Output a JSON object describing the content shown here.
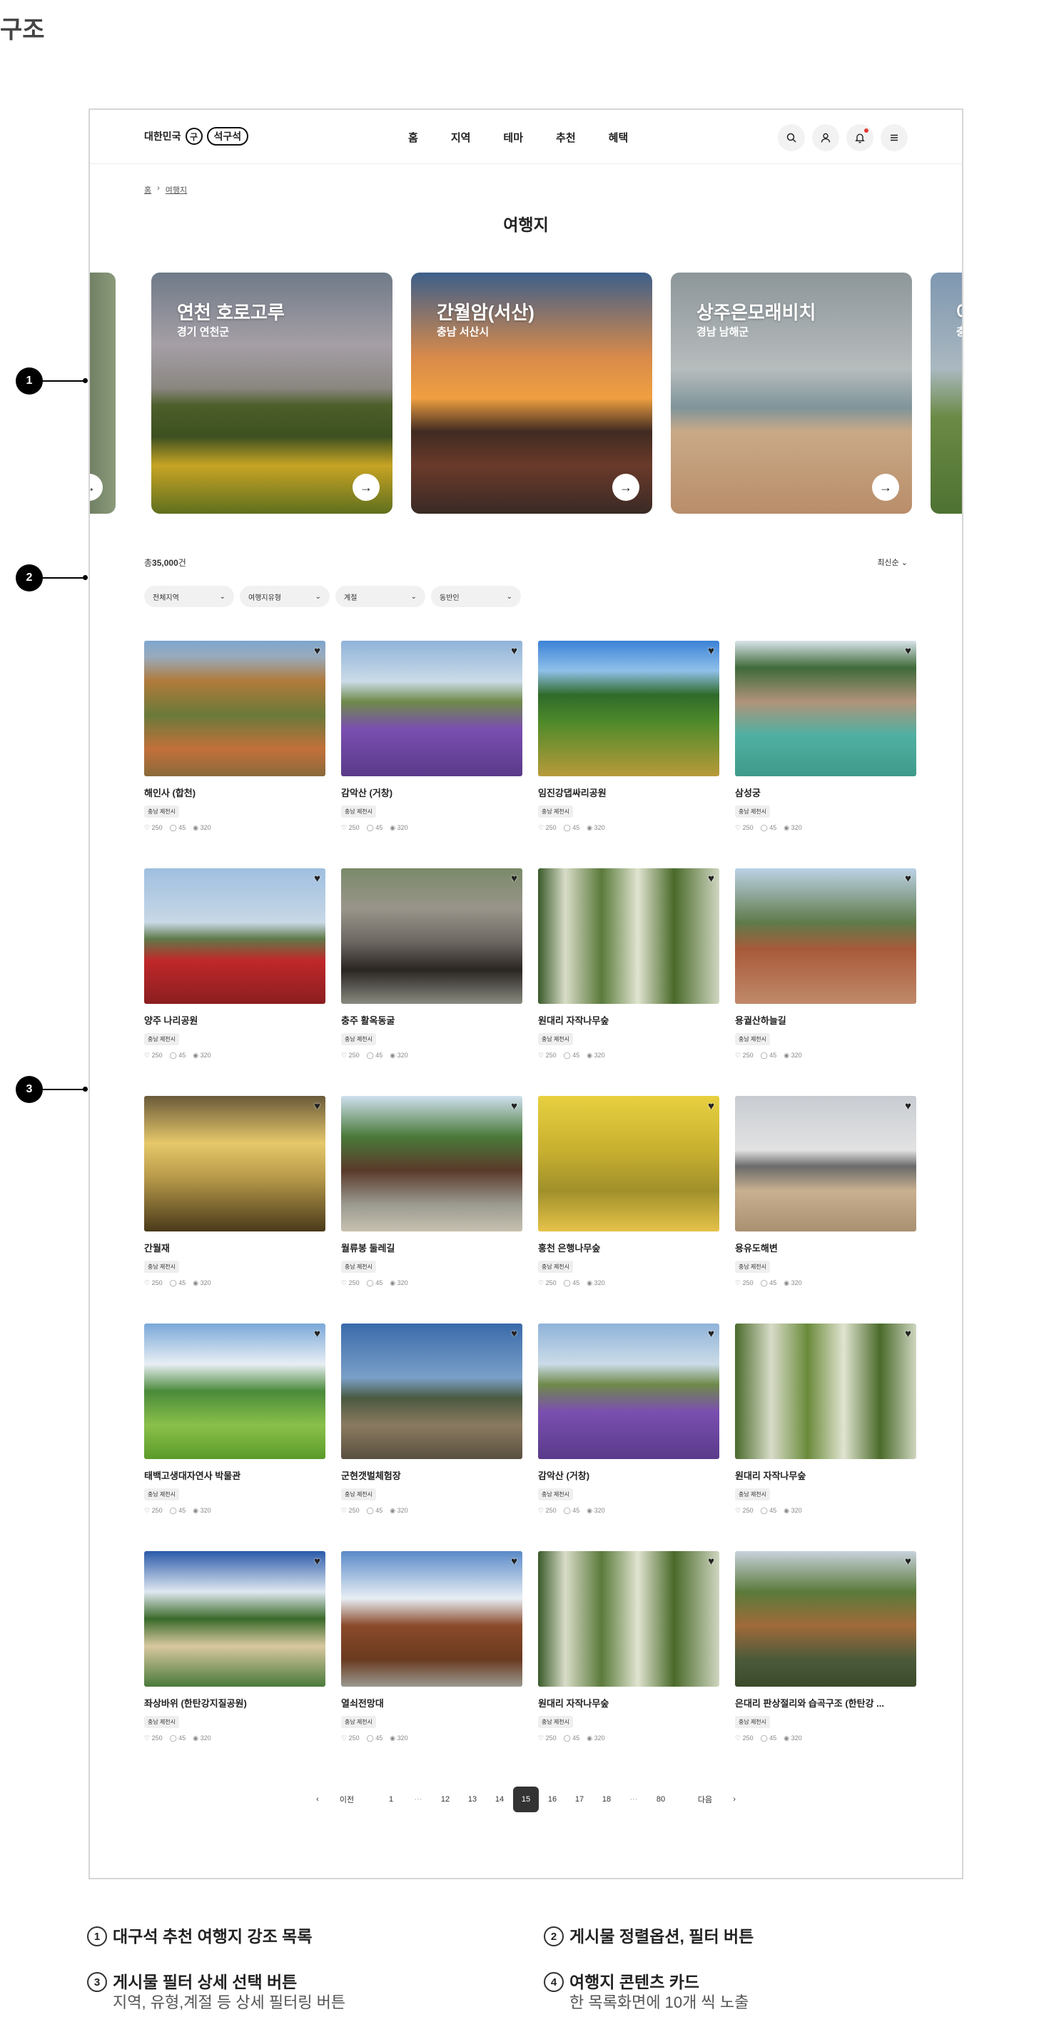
{
  "page_heading": "구조",
  "header": {
    "logo_prefix": "대한민국",
    "logo_circle": "구",
    "logo_name": "석구석",
    "nav": [
      "홈",
      "지역",
      "테마",
      "추천",
      "혜택"
    ]
  },
  "breadcrumb": {
    "home": "홈",
    "current": "여행지"
  },
  "title": "여행지",
  "carousel": [
    {
      "name": "연천 호로고루",
      "loc": "경기 연천군"
    },
    {
      "name": "간월암(서산)",
      "loc": "충남 서산시"
    },
    {
      "name": "상주은모래비치",
      "loc": "경남 남해군"
    },
    {
      "name": "아",
      "loc": "충남"
    }
  ],
  "count_prefix": "총",
  "count_value": "35,000",
  "count_suffix": "건",
  "sort_label": "최신순",
  "filters": [
    "전체지역",
    "여행지유형",
    "계절",
    "동반인"
  ],
  "cards": [
    {
      "name": "해인사 (합천)",
      "badge": "충남 제천시",
      "likes": "250",
      "comments": "45",
      "views": "320"
    },
    {
      "name": "감악산 (거창)",
      "badge": "충남 제천시",
      "likes": "250",
      "comments": "45",
      "views": "320"
    },
    {
      "name": "임진강댑싸리공원",
      "badge": "충남 제천시",
      "likes": "250",
      "comments": "45",
      "views": "320"
    },
    {
      "name": "삼성궁",
      "badge": "충남 제천시",
      "likes": "250",
      "comments": "45",
      "views": "320"
    },
    {
      "name": "양주 나리공원",
      "badge": "충남 제천시",
      "likes": "250",
      "comments": "45",
      "views": "320"
    },
    {
      "name": "충주 활옥동굴",
      "badge": "충남 제천시",
      "likes": "250",
      "comments": "45",
      "views": "320"
    },
    {
      "name": "원대리 자작나무숲",
      "badge": "충남 제천시",
      "likes": "250",
      "comments": "45",
      "views": "320"
    },
    {
      "name": "용궐산하늘길",
      "badge": "충남 제천시",
      "likes": "250",
      "comments": "45",
      "views": "320"
    },
    {
      "name": "간월재",
      "badge": "충남 제천시",
      "likes": "250",
      "comments": "45",
      "views": "320"
    },
    {
      "name": "월류봉 둘레길",
      "badge": "충남 제천시",
      "likes": "250",
      "comments": "45",
      "views": "320"
    },
    {
      "name": "홍천 은행나무숲",
      "badge": "충남 제천시",
      "likes": "250",
      "comments": "45",
      "views": "320"
    },
    {
      "name": "용유도해변",
      "badge": "충남 제천시",
      "likes": "250",
      "comments": "45",
      "views": "320"
    },
    {
      "name": "태백고생대자연사 박물관",
      "badge": "충남 제천시",
      "likes": "250",
      "comments": "45",
      "views": "320"
    },
    {
      "name": "군현갯벌체험장",
      "badge": "충남 제천시",
      "likes": "250",
      "comments": "45",
      "views": "320"
    },
    {
      "name": "감악산 (거창)",
      "badge": "충남 제천시",
      "likes": "250",
      "comments": "45",
      "views": "320"
    },
    {
      "name": "원대리 자작나무숲",
      "badge": "충남 제천시",
      "likes": "250",
      "comments": "45",
      "views": "320"
    },
    {
      "name": "좌상바위 (한탄강지질공원)",
      "badge": "충남 제천시",
      "likes": "250",
      "comments": "45",
      "views": "320"
    },
    {
      "name": "열쇠전망대",
      "badge": "충남 제천시",
      "likes": "250",
      "comments": "45",
      "views": "320"
    },
    {
      "name": "원대리 자작나무숲",
      "badge": "충남 제천시",
      "likes": "250",
      "comments": "45",
      "views": "320"
    },
    {
      "name": "은대리 판상절리와 습곡구조 (한탄강 ...",
      "badge": "충남 제천시",
      "likes": "250",
      "comments": "45",
      "views": "320"
    }
  ],
  "pager": {
    "prev": "이전",
    "next": "다음",
    "pages": [
      "1",
      "···",
      "12",
      "13",
      "14",
      "15",
      "16",
      "17",
      "18",
      "···",
      "80"
    ],
    "current": "15"
  },
  "markers": [
    "1",
    "2",
    "3"
  ],
  "legend": [
    {
      "num": "1",
      "text": "대구석 추천 여행지 강조 목록",
      "sub": ""
    },
    {
      "num": "2",
      "text": "게시물 정렬옵션, 필터 버튼",
      "sub": ""
    },
    {
      "num": "3",
      "text": "게시물 필터 상세 선택 버튼",
      "sub": "지역, 유형,계절 등 상세 필터링 버튼"
    },
    {
      "num": "4",
      "text": "여행지 콘텐츠 카드",
      "sub": "한 목록화면에 10개 씩 노출"
    }
  ]
}
